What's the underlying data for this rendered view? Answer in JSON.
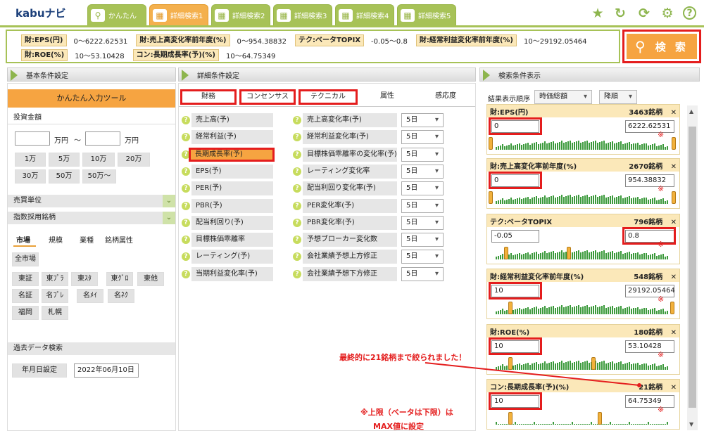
{
  "app": {
    "logo": "kabuナビ",
    "logo_small": "kabu"
  },
  "tabs": [
    {
      "label": "かんたん",
      "active": false
    },
    {
      "label": "詳細検索1",
      "active": true
    },
    {
      "label": "詳細検索2",
      "active": false
    },
    {
      "label": "詳細検索3",
      "active": false
    },
    {
      "label": "詳細検索4",
      "active": false
    },
    {
      "label": "詳細検索5",
      "active": false
    }
  ],
  "header_icons": [
    "star-icon",
    "refresh-icon",
    "sync-icon",
    "gear-icon",
    "help-icon"
  ],
  "summary": {
    "row1": [
      {
        "tag": "財:EPS(円)",
        "value": "0～6222.62531"
      },
      {
        "tag": "財:売上高変化率前年度(%)",
        "value": "0～954.38832"
      },
      {
        "tag": "テク:ベータTOPIX",
        "value": "-0.05～0.8"
      },
      {
        "tag": "財:経常利益変化率前年度(%)",
        "value": "10～29192.05464"
      }
    ],
    "row2": [
      {
        "tag": "財:ROE(%)",
        "value": "10～53.10428"
      },
      {
        "tag": "コン:長期成長率(予)(%)",
        "value": "10～64.75349"
      }
    ]
  },
  "search_button": "検 索",
  "panels": {
    "left": "基本条件設定",
    "middle": "詳細条件設定",
    "right": "検索条件表示"
  },
  "left": {
    "easy_tool": "かんたん入力ツール",
    "invest_label": "投資金額",
    "unit": "万円",
    "tilde": "～",
    "amount_buttons": [
      "1万",
      "5万",
      "10万",
      "20万",
      "30万",
      "50万",
      "50万～"
    ],
    "trade_unit": "売買単位",
    "index": "指数採用銘柄",
    "subtabs": [
      "市場",
      "規模",
      "業種",
      "銘柄属性"
    ],
    "all_market": "全市場",
    "markets": [
      "東証",
      "東ﾌﾟﾗ",
      "東ｽﾀ",
      "東ｸﾞﾛ",
      "東他",
      "名証",
      "名ﾌﾟﾚ",
      "名ﾒｲ",
      "名ﾈｸ",
      "福岡",
      "札幌"
    ],
    "past_data": "過去データ検索",
    "date_label": "年月日設定",
    "date_value": "2022年06月10日"
  },
  "middle": {
    "tabs": [
      "財務",
      "コンセンサス",
      "テクニカル",
      "属性",
      "感応度"
    ],
    "col1": [
      "売上高(予)",
      "経常利益(予)",
      "長期成長率(予)",
      "EPS(予)",
      "PER(予)",
      "PBR(予)",
      "配当利回り(予)",
      "目標株価乖離率",
      "レーティング(予)",
      "当期利益変化率(予)"
    ],
    "col2": [
      "売上高変化率(予)",
      "経常利益変化率(予)",
      "目標株価乖離率の変化率(予)",
      "レーティング変化率",
      "配当利回り変化率(予)",
      "PER変化率(予)",
      "PBR変化率(予)",
      "予想ブローカー変化数",
      "会社業績予想上方修正",
      "会社業績予想下方修正"
    ],
    "period": "5日",
    "highlight_index": 2
  },
  "right": {
    "order_label": "結果表示順序",
    "order_value": "時価総額",
    "order_dir": "降順",
    "close": "✕",
    "mark": "※",
    "cards": [
      {
        "title": "財:EPS(円)",
        "count": "3463銘柄",
        "min": "0",
        "max": "6222.62531"
      },
      {
        "title": "財:売上高変化率前年度(%)",
        "count": "2670銘柄",
        "min": "0",
        "max": "954.38832"
      },
      {
        "title": "テク:ベータTOPIX",
        "count": "796銘柄",
        "min": "-0.05",
        "max": "0.8"
      },
      {
        "title": "財:経常利益変化率前年度(%)",
        "count": "548銘柄",
        "min": "10",
        "max": "29192.05464"
      },
      {
        "title": "財:ROE(%)",
        "count": "180銘柄",
        "min": "10",
        "max": "53.10428"
      },
      {
        "title": "コン:長期成長率(予)(%)",
        "count": "21銘柄",
        "min": "10",
        "max": "64.75349"
      }
    ]
  },
  "annotations": {
    "final": "最終的に21銘柄まで絞られました！",
    "note1": "※上限（ベータは下限）は",
    "note2": "MAX値に設定"
  },
  "colors": {
    "accent_green": "#a7c257",
    "accent_orange": "#f6a441",
    "highlight_red": "#e41d1d"
  }
}
